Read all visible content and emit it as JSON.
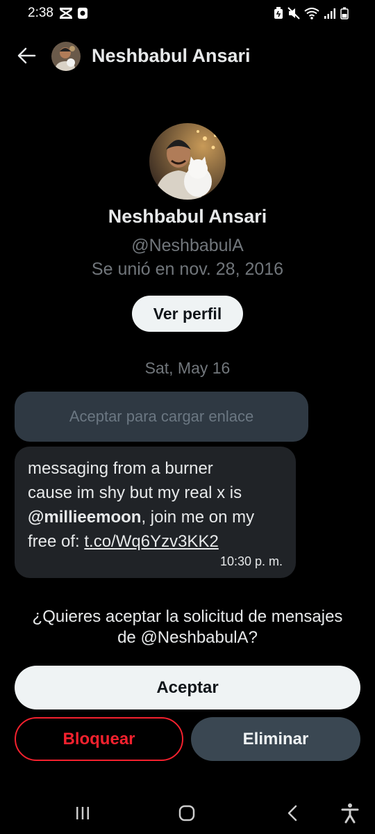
{
  "status_bar": {
    "time": "2:38",
    "left_icons": [
      "capcut-icon",
      "notification-box-icon"
    ],
    "right_icons": [
      "battery-saver-icon",
      "mute-icon",
      "wifi-icon",
      "signal-icon",
      "battery-icon"
    ]
  },
  "header": {
    "name": "Neshbabul Ansari"
  },
  "profile": {
    "name": "Neshbabul Ansari",
    "handle": "@NeshbabulA",
    "joined": "Se unió en nov. 28, 2016",
    "view_profile_label": "Ver perfil"
  },
  "conversation": {
    "date": "Sat, May 16",
    "link_preview_label": "Aceptar para cargar enlace",
    "message": {
      "line1": "messaging from a burner",
      "line2": "cause im shy but my real x is",
      "mention": "@millieemoon",
      "after_mention": ", join me on my",
      "line4_prefix": "free of: ",
      "link": "t.co/Wq6Yzv3KK2",
      "time": "10:30 p. m."
    }
  },
  "request": {
    "prompt_line1": "¿Quieres aceptar la solicitud de mensajes",
    "prompt_line2": "de @NeshbabulA?",
    "accept_label": "Aceptar",
    "block_label": "Bloquear",
    "delete_label": "Eliminar"
  },
  "colors": {
    "background": "#000000",
    "primary_text": "#e7e9ea",
    "secondary_text": "#71767b",
    "danger": "#f4212e",
    "bubble": "#202327"
  }
}
